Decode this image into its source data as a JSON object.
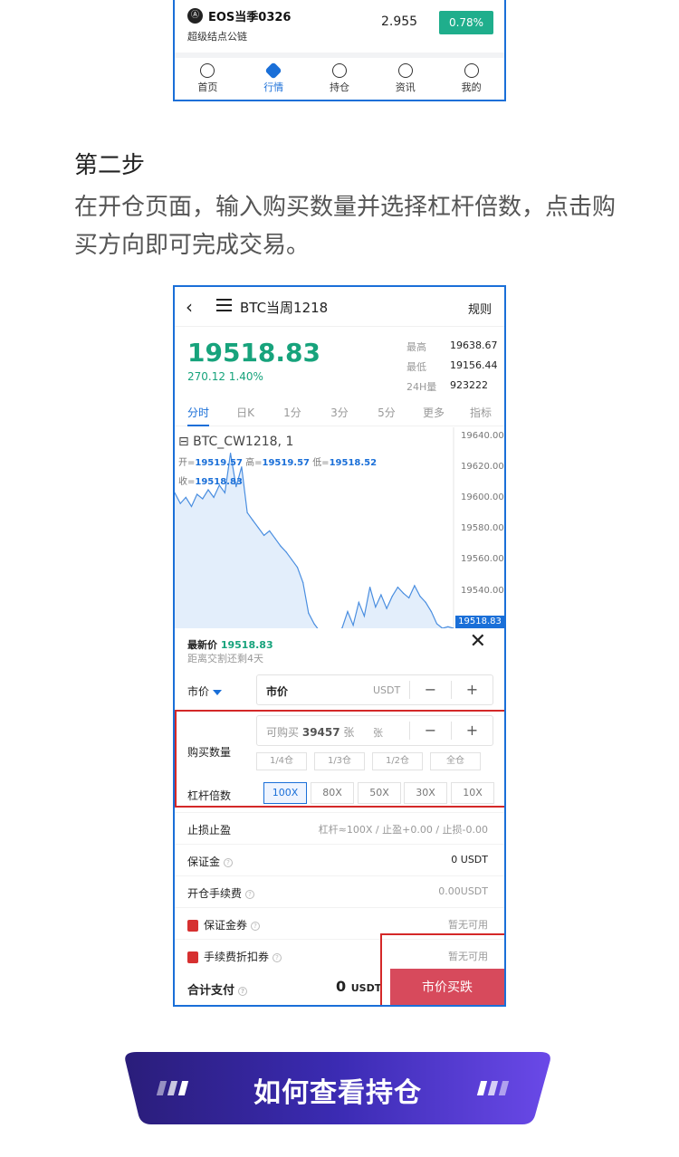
{
  "top_snippet": {
    "eos": {
      "logo": "Ⓐ",
      "name": "EOS当季0326",
      "sub": "超级结点公链",
      "price": "2.955",
      "change": "0.78%"
    },
    "tabs": [
      "首页",
      "行情",
      "持仓",
      "资讯",
      "我的"
    ],
    "active_tab": "行情"
  },
  "step": {
    "title": "第二步",
    "description": "在开仓页面，输入购买数量并选择杠杆倍数，点击购买方向即可完成交易。"
  },
  "contract": {
    "back_icon": "‹",
    "title": "BTC当周1218",
    "rules": "规则",
    "price": "19518.83",
    "change": "270.12  1.40%",
    "stats": [
      {
        "k": "最高",
        "v": "19638.67"
      },
      {
        "k": "最低",
        "v": "19156.44"
      },
      {
        "k": "24H量",
        "v": "923222"
      }
    ],
    "chart_tabs": [
      "分时",
      "日K",
      "1分",
      "3分",
      "5分",
      "更多",
      "指标"
    ],
    "symbol": "⊟ BTC_CW1218, 1",
    "ohlc": {
      "open_k": "开=",
      "open_v": "19519.57",
      "high_k": "高=",
      "high_v": "19519.57",
      "low_k": "低=",
      "low_v": "19518.52",
      "close_k": "收=",
      "close_v": "19518.83"
    },
    "y_ticks": [
      "19640.00",
      "19620.00",
      "19600.00",
      "19580.00",
      "19560.00",
      "19540.00"
    ],
    "last_tag": "19518.83"
  },
  "order": {
    "latest_label": "最新价",
    "latest_value": "19518.83",
    "settle": "距离交割还剩4天",
    "close": "✕",
    "price_type": "市价",
    "price_field": "市价",
    "price_unit": "USDT",
    "minus": "−",
    "plus": "+",
    "qty_label": "购买数量",
    "qty_placeholder_prefix": "可购买",
    "qty_placeholder_value": "39457",
    "qty_placeholder_suffix": "张",
    "qty_unit": "张",
    "fractions": [
      "1/4仓",
      "1/3仓",
      "1/2仓",
      "全仓"
    ],
    "leverage_label": "杠杆倍数",
    "leverages": [
      "100X",
      "80X",
      "50X",
      "30X",
      "10X"
    ],
    "selected_leverage": "100X",
    "rows": [
      {
        "k": "止损止盈",
        "v": "杠杆≈100X / 止盈+0.00 / 止损-0.00"
      },
      {
        "k": "保证金",
        "v": "0 USDT"
      },
      {
        "k": "开仓手续费",
        "v": "0.00USDT"
      },
      {
        "k": "保证金券",
        "v": "暂无可用"
      },
      {
        "k": "手续费折扣券",
        "v": "暂无可用"
      }
    ],
    "total_label": "合计支付",
    "total_value": "0",
    "total_unit": "USDT",
    "buy_button": "市价买跌"
  },
  "banner": {
    "text": "如何查看持仓"
  },
  "chart_data": {
    "type": "line",
    "title": "",
    "ylim": [
      19518,
      19650
    ],
    "x": [
      0,
      1,
      2,
      3,
      4,
      5,
      6,
      7,
      8,
      9,
      10,
      11,
      12,
      13,
      14,
      15,
      16,
      17,
      18,
      19,
      20,
      21,
      22,
      23,
      24,
      25,
      26,
      27,
      28,
      29,
      30,
      31,
      32,
      33,
      34,
      35,
      36,
      37,
      38,
      39,
      40,
      41,
      42,
      43,
      44,
      45,
      46,
      47,
      48,
      49,
      50
    ],
    "values": [
      19607,
      19600,
      19604,
      19598,
      19606,
      19603,
      19609,
      19604,
      19612,
      19607,
      19633,
      19611,
      19624,
      19594,
      19589,
      19584,
      19579,
      19582,
      19577,
      19572,
      19568,
      19563,
      19558,
      19548,
      19528,
      19521,
      19516,
      19515,
      19514,
      19516,
      19518,
      19529,
      19520,
      19535,
      19526,
      19545,
      19532,
      19540,
      19531,
      19539,
      19545,
      19541,
      19538,
      19546,
      19539,
      19535,
      19529,
      19521,
      19518,
      19519,
      19518
    ]
  }
}
